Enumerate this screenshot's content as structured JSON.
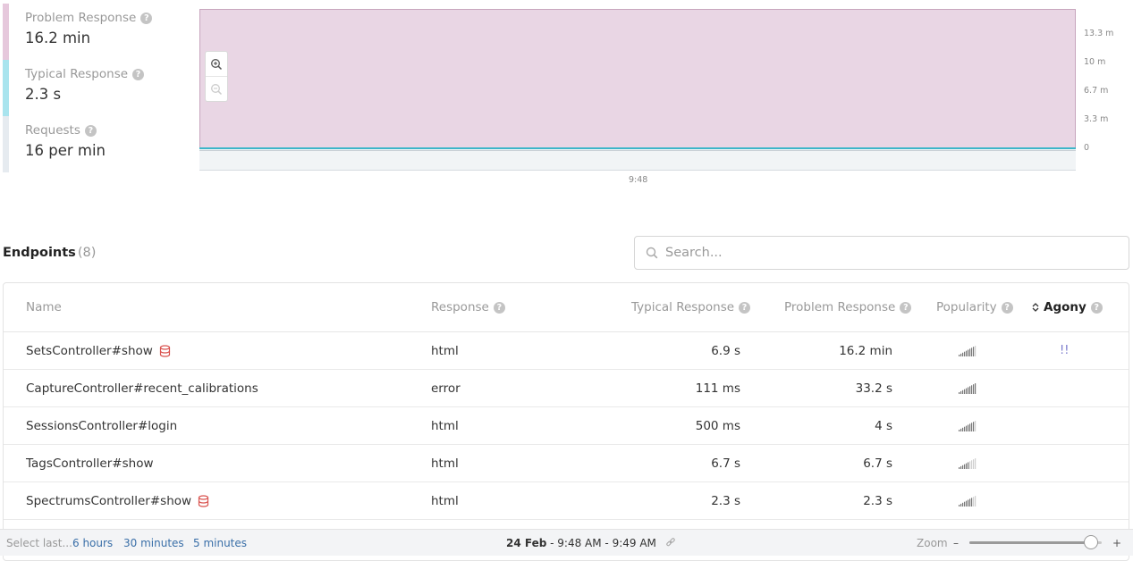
{
  "metrics": [
    {
      "label": "Problem Response",
      "value": "16.2 min",
      "color": "#e6c8dc"
    },
    {
      "label": "Typical Response",
      "value": "2.3 s",
      "color": "#a9e4ee"
    },
    {
      "label": "Requests",
      "value": "16 per min",
      "color": "#e6ebf0"
    }
  ],
  "chart": {
    "y_ticks": [
      "13.3 m",
      "10 m",
      "6.7 m",
      "3.3 m",
      "0"
    ],
    "x_ticks": [
      "9:48"
    ],
    "zoom_in_icon": "zoom-in-icon",
    "zoom_out_icon": "zoom-out-icon"
  },
  "chart_data": {
    "type": "area",
    "x": [
      "9:48"
    ],
    "series": [
      {
        "name": "Problem Response",
        "values": [
          16.2
        ],
        "color": "#e9d6e4"
      },
      {
        "name": "Typical Response",
        "values": [
          0.04
        ],
        "color": "#3db6c9"
      }
    ],
    "yticks": [
      "13.3 m",
      "10 m",
      "6.7 m",
      "3.3 m",
      "0"
    ]
  },
  "endpoints": {
    "title": "Endpoints",
    "count": "(8)",
    "search_placeholder": "Search...",
    "columns": {
      "name": "Name",
      "response": "Response",
      "typical": "Typical Response",
      "problem": "Problem Response",
      "popularity": "Popularity",
      "agony": "Agony"
    },
    "rows": [
      {
        "name": "SetsController#show",
        "db": true,
        "response": "html",
        "typical": "6.9 s",
        "problem": "16.2 min",
        "popularity": 0.9,
        "agony": "!!"
      },
      {
        "name": "CaptureController#recent_calibrations",
        "db": false,
        "response": "error",
        "typical": "111 ms",
        "problem": "33.2 s",
        "popularity": 1.0,
        "agony": ""
      },
      {
        "name": "SessionsController#login",
        "db": false,
        "response": "html",
        "typical": "500 ms",
        "problem": "4 s",
        "popularity": 0.85,
        "agony": ""
      },
      {
        "name": "TagsController#show",
        "db": false,
        "response": "html",
        "typical": "6.7 s",
        "problem": "6.7 s",
        "popularity": 0.6,
        "agony": ""
      },
      {
        "name": "SpectrumsController#show",
        "db": true,
        "response": "html",
        "typical": "2.3 s",
        "problem": "2.3 s",
        "popularity": 0.75,
        "agony": ""
      }
    ]
  },
  "bottom": {
    "select_label": "Select last...",
    "options": [
      "6 hours",
      "30 minutes",
      "5 minutes"
    ],
    "date": "24 Feb",
    "time_range": " - 9:48 AM - 9:49 AM",
    "zoom_label": "Zoom",
    "zoom_minus": "–",
    "zoom_plus": "+",
    "zoom_level": 0.92
  },
  "colors": {
    "accent_link": "#3a6fa8",
    "db_icon": "#d9534f",
    "problem_area": "#e9d6e4",
    "typical_line": "#3db6c9"
  }
}
